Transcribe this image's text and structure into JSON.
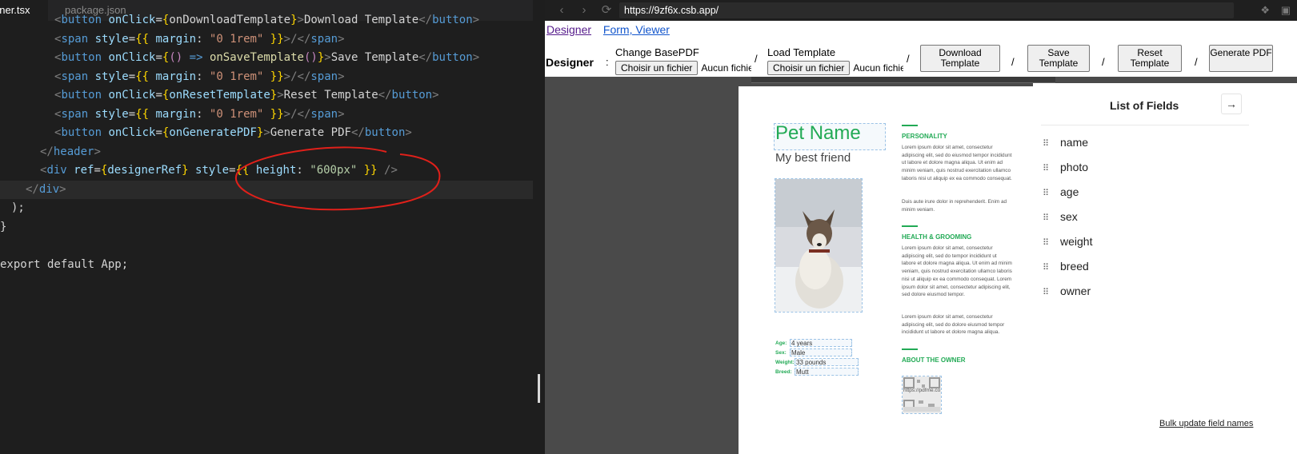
{
  "editor": {
    "tabs": [
      {
        "label": "gner.tsx"
      },
      {
        "label": "package.json"
      }
    ],
    "lines": {
      "l0": "<button onClick={onDownloadTemplate}>Download Template</button>",
      "l1_tag": "span",
      "l1_attr": "style",
      "l1_margin": "margin",
      "l1_val": "\"0 1rem\"",
      "l2_attr": "onClick",
      "l2_fn": "onSaveTemplate",
      "l2_text": "Save Template",
      "l3_val": "\"0 1rem\"",
      "l4_fn": "onResetTemplate",
      "l4_text": "Reset Template",
      "l5_val": "\"0 1rem\"",
      "l6_fn": "onGeneratePDF",
      "l6_text": "Generate PDF",
      "l7": "header",
      "l8_ref": "designerRef",
      "l8_height": "height",
      "l8_val": "\"600px\"",
      "l9": "div",
      "l10": ");",
      "l11": "}",
      "l13": "export default App;"
    }
  },
  "browser": {
    "url": "https://9zf6x.csb.app/",
    "links": [
      {
        "label": "Designer"
      },
      {
        "label": "Form, Viewer"
      }
    ],
    "header": {
      "designer_label": "Designer",
      "colon": ":",
      "change_base_pdf": "Change BasePDF",
      "load_template": "Load Template",
      "choose_file": "Choisir un fichier",
      "no_file": "Aucun fichier choisi",
      "sep": "/",
      "download_template": "Download Template",
      "save_template": "Save Template",
      "reset_template": "Reset Template",
      "generate_pdf": "Generate PDF"
    },
    "page": {
      "pet_name": "Pet Name",
      "best_friend": "My best friend",
      "info": [
        {
          "label": "Age:",
          "value": "4 years"
        },
        {
          "label": "Sex:",
          "value": "Male"
        },
        {
          "label": "Weight:",
          "value": "33 pounds"
        },
        {
          "label": "Breed:",
          "value": "Mutt"
        }
      ],
      "sections": {
        "personality": "PERSONALITY",
        "health": "HEALTH & GROOMING",
        "owner": "ABOUT THE OWNER"
      },
      "lorem1": "Lorem ipsum dolor sit amet, consectetur adipiscing elit, sed do eiusmod tempor incididunt ut labore et dolore magna aliqua. Ut enim ad minim veniam, quis nostrud exercitation ullamco laboris nisi ut aliquip ex ea commodo consequat.",
      "lorem2": "Duis aute irure dolor in reprehenderit. Enim ad minim veniam.",
      "lorem3": "Lorem ipsum dolor sit amet, consectetur adipiscing elit, sed do tempor incididunt ut labore et dolore magna aliqua. Ut enim ad minim veniam, quis nostrud exercitation ullamco laboris nisi ut aliquip ex ea commodo consequat. Lorem ipsum dolor sit amet, consectetur adipiscing elit, sed dolore eiusmod tempor.",
      "lorem4": "Lorem ipsum dolor sit amet, consectetur adipiscing elit, sed do dolore eiusmod tempor incididunt ut labore et dolore magna aliqua.",
      "qr_text": "https://pdfme.com"
    },
    "fields_panel": {
      "title": "List of Fields",
      "items": [
        "name",
        "photo",
        "age",
        "sex",
        "weight",
        "breed",
        "owner"
      ],
      "bulk_update": "Bulk update field names"
    }
  },
  "colors": {
    "accent_green": "#22aa55",
    "annotation_red": "#e0201a",
    "editor_bg": "#1e1e1e"
  }
}
